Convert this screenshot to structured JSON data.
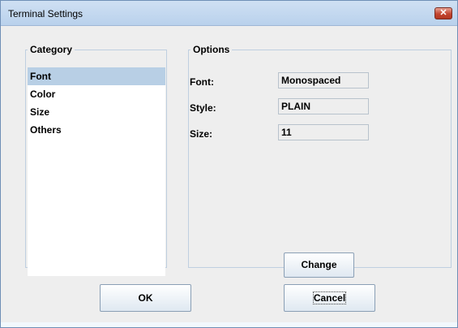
{
  "window": {
    "title": "Terminal Settings",
    "close_icon": "close-icon"
  },
  "category": {
    "legend": "Category",
    "items": [
      "Font",
      "Color",
      "Size",
      "Others"
    ],
    "selected": "Font"
  },
  "options": {
    "legend": "Options",
    "font_label": "Font:",
    "font_value": "Monospaced",
    "style_label": "Style:",
    "style_value": "PLAIN",
    "size_label": "Size:",
    "size_value": "11",
    "change_label": "Change"
  },
  "buttons": {
    "ok_label": "OK",
    "cancel_label": "Cancel"
  },
  "colors": {
    "selection": "#b8cfe5",
    "close_button": "#c2452f",
    "panel_bg": "#eeeeee"
  }
}
